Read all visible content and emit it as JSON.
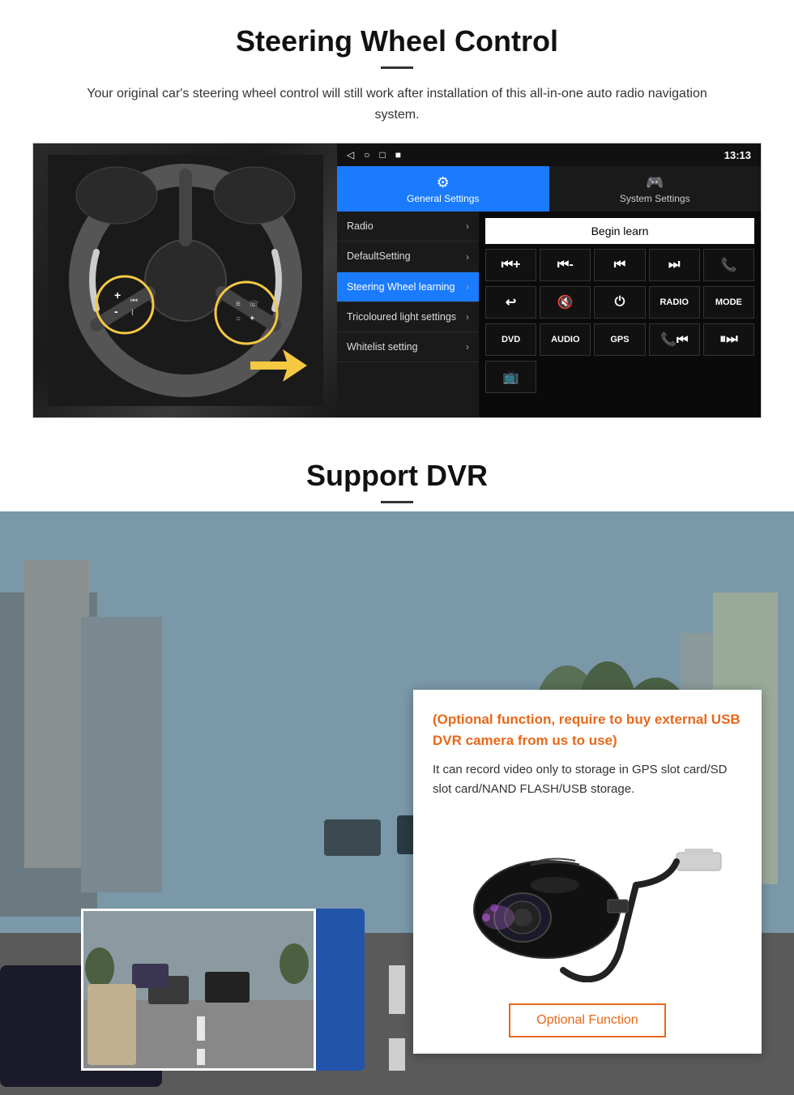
{
  "steering_section": {
    "title": "Steering Wheel Control",
    "description": "Your original car's steering wheel control will still work after installation of this all-in-one auto radio navigation system.",
    "status_bar": {
      "time": "13:13",
      "signal": "▼",
      "wifi": "▼"
    },
    "nav_icons": [
      "◁",
      "○",
      "□",
      "■"
    ],
    "tabs": {
      "general": {
        "icon": "⚙",
        "label": "General Settings"
      },
      "system": {
        "icon": "🎮",
        "label": "System Settings"
      }
    },
    "menu_items": [
      {
        "label": "Radio",
        "active": false
      },
      {
        "label": "DefaultSetting",
        "active": false
      },
      {
        "label": "Steering Wheel learning",
        "active": true
      },
      {
        "label": "Tricoloured light settings",
        "active": false
      },
      {
        "label": "Whitelist setting",
        "active": false
      }
    ],
    "begin_learn_label": "Begin learn",
    "control_buttons": [
      "⏮+",
      "⏮-",
      "⏮⏮",
      "⏭⏭",
      "📞",
      "↩",
      "🔇x",
      "⏻",
      "RADIO",
      "MODE"
    ],
    "bottom_buttons": [
      "DVD",
      "AUDIO",
      "GPS",
      "📞⏮",
      "⏸⏭"
    ],
    "bottom_icon": "📺"
  },
  "dvr_section": {
    "title": "Support DVR",
    "info_title": "(Optional function, require to buy external USB DVR camera from us to use)",
    "info_desc": "It can record video only to storage in GPS slot card/SD slot card/NAND FLASH/USB storage.",
    "optional_btn_label": "Optional Function"
  }
}
